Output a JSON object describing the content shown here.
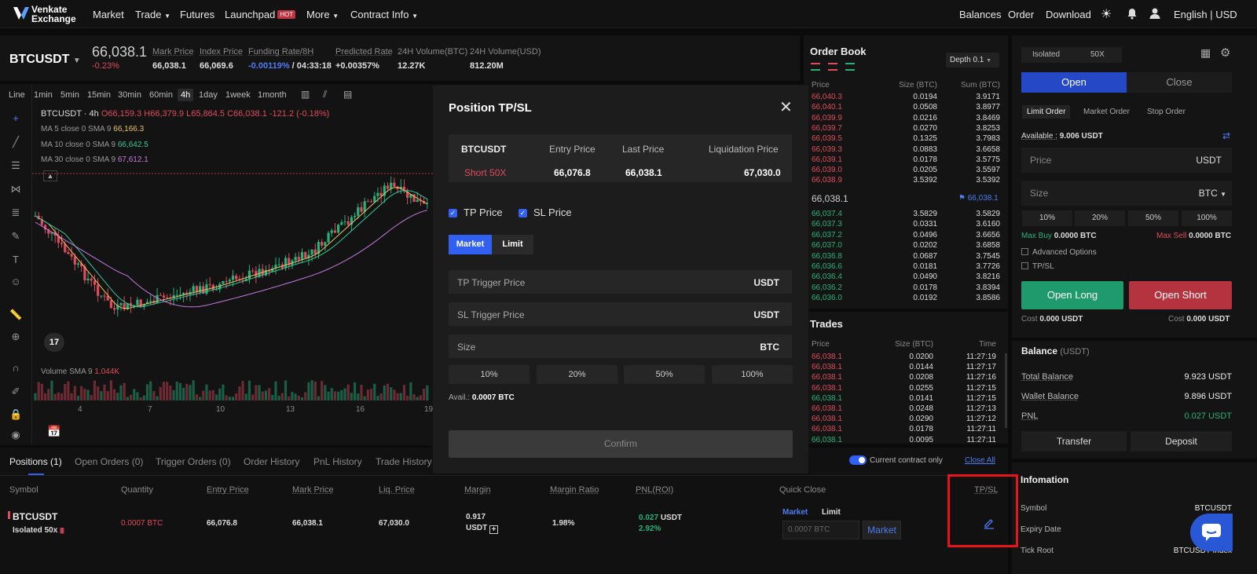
{
  "nav": {
    "logo_line1": "Venkate",
    "logo_line2": "Exchange",
    "items": [
      "Market",
      "Trade",
      "Futures",
      "Launchpad",
      "More",
      "Contract Info"
    ],
    "hot_badge": "HOT",
    "right": [
      "Balances",
      "Order",
      "Download"
    ],
    "lang": "English | USD"
  },
  "ticker": {
    "symbol": "BTCUSDT",
    "last": "66,038.1",
    "change": "-0.23%",
    "labels": [
      "Mark Price",
      "Index Price",
      "Funding Rate/8H",
      "Predicted Rate",
      "24H Volume(BTC)",
      "24H Volume(USD)"
    ],
    "mark": "66,038.1",
    "index": "66,069.6",
    "funding": "-0.00119%",
    "funding_time": "/ 04:33:18",
    "predicted": "+0.00357%",
    "vol_btc": "12.27K",
    "vol_usd": "812.20M"
  },
  "chart": {
    "timeframes": [
      "Line",
      "1min",
      "5min",
      "15min",
      "30min",
      "60min",
      "4h",
      "1day",
      "1week",
      "1month"
    ],
    "active_tf": "4h",
    "legend_title": "BTCUSDT · 4h",
    "ohlc": "O66,159.3 H66,379.9 L65,864.5 C66,038.1 -121.2 (-0.18%)",
    "ma5_label": "MA 5 close 0 SMA 9",
    "ma5_val": "66,166.3",
    "ma10_label": "MA 10 close 0 SMA 9",
    "ma10_val": "66,642.5",
    "ma30_label": "MA 30 close 0 SMA 9",
    "ma30_val": "67,612.1",
    "volume_label": "Volume SMA 9",
    "volume_val": "1.044K",
    "x_labels": [
      "4",
      "7",
      "10",
      "13",
      "16",
      "19"
    ],
    "tv_logo": "17"
  },
  "orderbook": {
    "title": "Order Book",
    "depth": "Depth 0.1",
    "headers": [
      "Price",
      "Size (BTC)",
      "Sum (BTC)"
    ],
    "asks": [
      [
        "66,040.3",
        "0.0194",
        "3.9171"
      ],
      [
        "66,040.1",
        "0.0508",
        "3.8977"
      ],
      [
        "66,039.9",
        "0.0216",
        "3.8469"
      ],
      [
        "66,039.7",
        "0.0270",
        "3.8253"
      ],
      [
        "66,039.5",
        "0.1325",
        "3.7983"
      ],
      [
        "66,039.3",
        "0.0883",
        "3.6658"
      ],
      [
        "66,039.1",
        "0.0178",
        "3.5775"
      ],
      [
        "66,039.0",
        "0.0205",
        "3.5597"
      ],
      [
        "66,038.9",
        "3.5392",
        "3.5392"
      ]
    ],
    "mid": "66,038.1",
    "mid_mark": "66,038.1",
    "bids": [
      [
        "66,037.4",
        "3.5829",
        "3.5829"
      ],
      [
        "66,037.3",
        "0.0331",
        "3.6160"
      ],
      [
        "66,037.2",
        "0.0496",
        "3.6656"
      ],
      [
        "66,037.0",
        "0.0202",
        "3.6858"
      ],
      [
        "66,036.8",
        "0.0687",
        "3.7545"
      ],
      [
        "66,036.6",
        "0.0181",
        "3.7726"
      ],
      [
        "66,036.4",
        "0.0490",
        "3.8216"
      ],
      [
        "66,036.2",
        "0.0178",
        "3.8394"
      ],
      [
        "66,036.0",
        "0.0192",
        "3.8586"
      ]
    ]
  },
  "trades": {
    "title": "Trades",
    "headers": [
      "Price",
      "Size (BTC)",
      "Time"
    ],
    "rows": [
      [
        "66,038.1",
        "0.0200",
        "11:27:19",
        "red"
      ],
      [
        "66,038.1",
        "0.0144",
        "11:27:17",
        "red"
      ],
      [
        "66,038.1",
        "0.0208",
        "11:27:16",
        "red"
      ],
      [
        "66,038.1",
        "0.0255",
        "11:27:15",
        "red"
      ],
      [
        "66,038.1",
        "0.0141",
        "11:27:15",
        "green"
      ],
      [
        "66,038.1",
        "0.0248",
        "11:27:13",
        "red"
      ],
      [
        "66,038.1",
        "0.0290",
        "11:27:12",
        "red"
      ],
      [
        "66,038.1",
        "0.0178",
        "11:27:11",
        "red"
      ],
      [
        "66,038.1",
        "0.0095",
        "11:27:11",
        "green"
      ]
    ]
  },
  "modal": {
    "title": "Position TP/SL",
    "info_headers": [
      "BTCUSDT",
      "Entry Price",
      "Last Price",
      "Liquidation Price"
    ],
    "side": "Short 50X",
    "entry": "66,076.8",
    "last": "66,038.1",
    "liq": "67,030.0",
    "tp_label": "TP Price",
    "sl_label": "SL Price",
    "tab_market": "Market",
    "tab_limit": "Limit",
    "tp_trigger": "TP Trigger Price",
    "sl_trigger": "SL Trigger Price",
    "size": "Size",
    "usdt": "USDT",
    "btc": "BTC",
    "pcts": [
      "10%",
      "20%",
      "50%",
      "100%"
    ],
    "avail_label": "Avail.:",
    "avail_val": "0.0007 BTC",
    "confirm": "Confirm"
  },
  "positions": {
    "tabs": [
      "Positions (1)",
      "Open Orders (0)",
      "Trigger Orders (0)",
      "Order History",
      "PnL History",
      "Trade History"
    ],
    "current_only": "Current contract only",
    "close_all": "Close All",
    "headers": [
      "Symbol",
      "Quantity",
      "Entry Price",
      "Mark Price",
      "Liq. Price",
      "Margin",
      "Margin Ratio",
      "PNL(ROI)",
      "Quick Close",
      "TP/SL"
    ],
    "row": {
      "symbol": "BTCUSDT",
      "mode": "Isolated 50x",
      "qty": "0.0007 BTC",
      "entry": "66,076.8",
      "mark": "66,038.1",
      "liq": "67,030.0",
      "margin_val": "0.917",
      "margin_unit": "USDT",
      "margin_ratio": "1.98%",
      "pnl": "0.027",
      "pnl_unit": "USDT",
      "roi": "2.92%",
      "qc_market": "Market",
      "qc_limit": "Limit",
      "qc_placeholder": "0.0007 BTC",
      "qc_button": "Market"
    }
  },
  "right": {
    "isolated": "Isolated",
    "leverage": "50X",
    "open": "Open",
    "close": "Close",
    "order_types": [
      "Limit Order",
      "Market Order",
      "Stop Order"
    ],
    "available_label": "Available :",
    "available_val": "9.006 USDT",
    "price": "Price",
    "price_unit": "USDT",
    "size": "Size",
    "size_unit": "BTC",
    "pcts": [
      "10%",
      "20%",
      "50%",
      "100%"
    ],
    "max_buy_label": "Max Buy",
    "max_buy": "0.0000 BTC",
    "max_sell_label": "Max Sell",
    "max_sell": "0.0000 BTC",
    "advanced": "Advanced Options",
    "tpsl": "TP/SL",
    "open_long": "Open Long",
    "open_short": "Open Short",
    "cost_label": "Cost",
    "cost_long": "0.000 USDT",
    "cost_short": "0.000 USDT",
    "balance_title": "Balance",
    "balance_unit": "(USDT)",
    "total_balance_label": "Total Balance",
    "total_balance": "9.923 USDT",
    "wallet_balance_label": "Wallet Balance",
    "wallet_balance": "9.896 USDT",
    "pnl_label": "PNL",
    "pnl": "0.027 USDT",
    "transfer": "Transfer",
    "deposit": "Deposit",
    "info_title": "Infomation",
    "info_symbol_label": "Symbol",
    "info_symbol": "BTCUSDT",
    "info_expiry_label": "Expiry Date",
    "info_tick_label": "Tick Root",
    "info_tick": "BTCUSDT Index"
  },
  "colors": {
    "accent": "#3160f2",
    "green": "#27b27a",
    "red": "#e04b5c",
    "highlight": "#e8141c"
  }
}
